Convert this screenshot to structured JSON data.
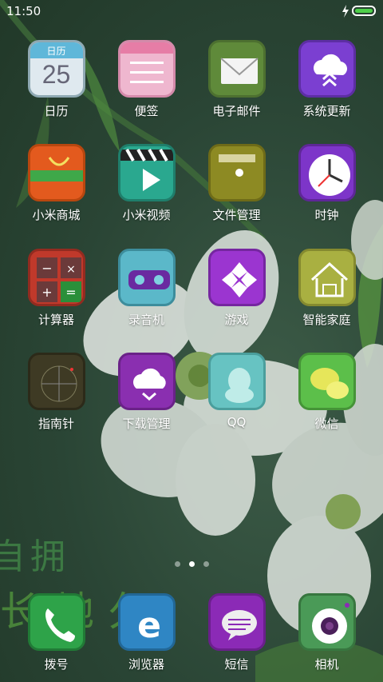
{
  "status_bar": {
    "time": "11:50"
  },
  "calendar": {
    "month": "日历",
    "day": "25"
  },
  "apps": [
    {
      "label": "日历"
    },
    {
      "label": "便签"
    },
    {
      "label": "电子邮件"
    },
    {
      "label": "系统更新"
    },
    {
      "label": "小米商城"
    },
    {
      "label": "小米视频"
    },
    {
      "label": "文件管理"
    },
    {
      "label": "时钟"
    },
    {
      "label": "计算器"
    },
    {
      "label": "录音机"
    },
    {
      "label": "游戏"
    },
    {
      "label": "智能家庭"
    },
    {
      "label": "指南针"
    },
    {
      "label": "下载管理"
    },
    {
      "label": "QQ"
    },
    {
      "label": "微信"
    }
  ],
  "dock": [
    {
      "label": "拨号"
    },
    {
      "label": "浏览器"
    },
    {
      "label": "短信"
    },
    {
      "label": "相机"
    }
  ],
  "pager": {
    "page_count": 3,
    "current_page": 2
  },
  "wallpaper_text": {
    "line1": "自拥",
    "line2": "长地久"
  }
}
